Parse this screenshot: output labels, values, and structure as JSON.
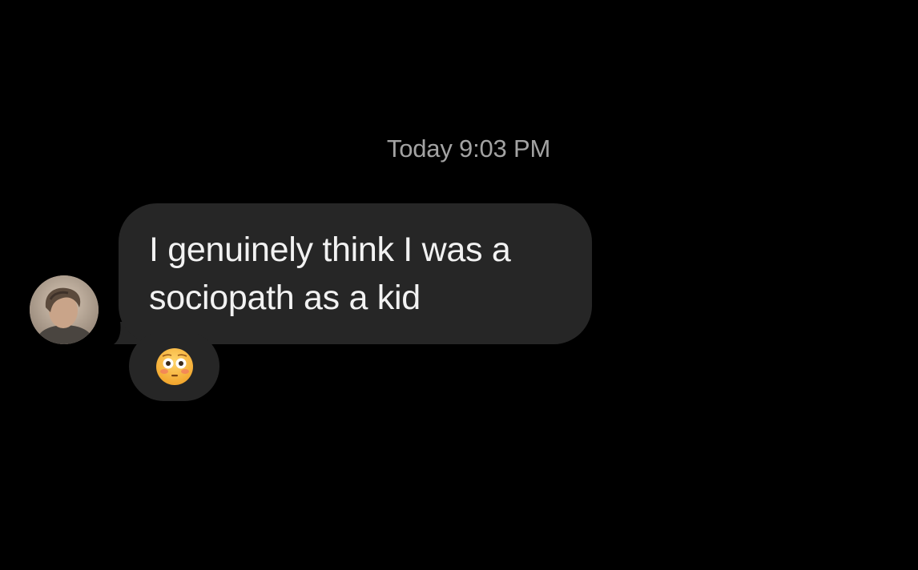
{
  "conversation": {
    "timestamp": "Today 9:03 PM",
    "message": {
      "lines": [
        "I genuinely think I was a",
        "sociopath as a kid"
      ],
      "reaction": {
        "emoji": "😳",
        "icon": "flushed-face-emoji-icon"
      }
    },
    "sender_avatar": {
      "icon": "user-avatar-photo"
    }
  },
  "colors": {
    "background": "#000000",
    "bubble": "#262626",
    "message_text": "#f2f2f2",
    "timestamp_text": "#a3a3a3",
    "emoji_face": "#f7b53a"
  }
}
